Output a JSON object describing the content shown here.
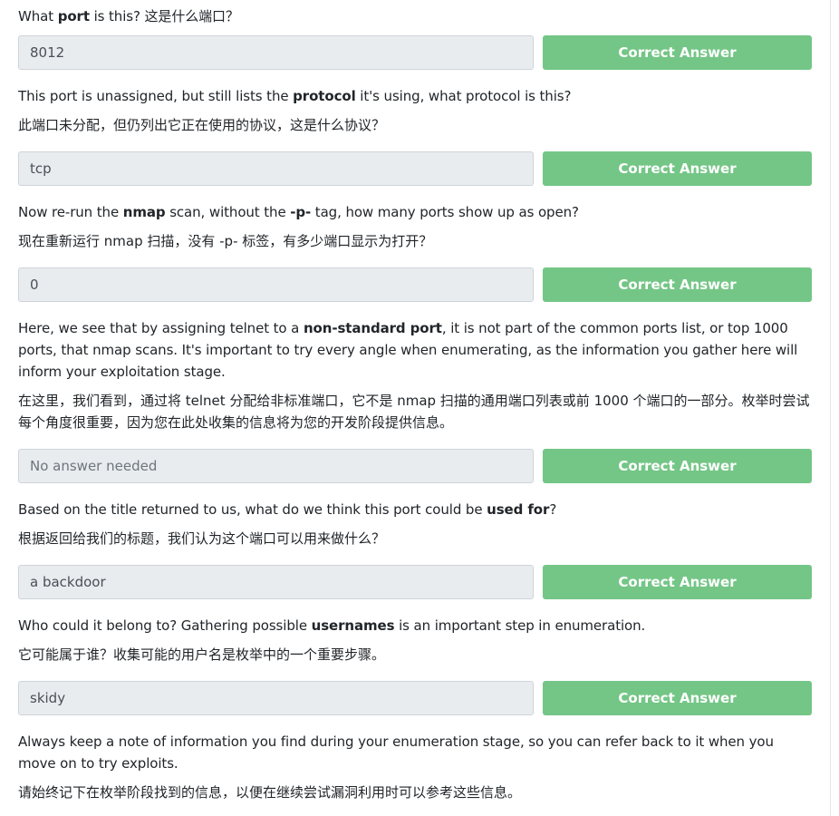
{
  "questions": [
    {
      "en_parts": [
        "What ",
        "port",
        " is this? 这是什么端口？"
      ],
      "zh": "",
      "answer": "8012",
      "button": "Correct Answer"
    },
    {
      "en_parts": [
        "This port is unassigned, but still lists the ",
        "protocol",
        " it's using, what protocol is this?"
      ],
      "zh": "此端口未分配，但仍列出它正在使用的协议，这是什么协议？",
      "answer": "tcp",
      "button": "Correct Answer"
    },
    {
      "en_parts": [
        "Now re-run the ",
        "nmap",
        " scan, without the ",
        "-p-",
        " tag, how many ports show up as open?"
      ],
      "zh": "现在重新运行 nmap 扫描，没有 -p- 标签，有多少端口显示为打开？",
      "answer": "0",
      "button": "Correct Answer"
    },
    {
      "en_parts": [
        "Here, we see that by assigning telnet to a ",
        "non-standard port",
        ", it is not part of the common ports list, or top 1000 ports, that nmap scans. It's important to try every angle when enumerating, as the information you gather here will inform your exploitation stage."
      ],
      "zh": "在这里，我们看到，通过将 telnet 分配给非标准端口，它不是 nmap 扫描的通用端口列表或前 1000 个端口的一部分。枚举时尝试每个角度很重要，因为您在此处收集的信息将为您的开发阶段提供信息。",
      "answer": "No answer needed",
      "button": "Correct Answer"
    },
    {
      "en_parts": [
        "Based on the title returned to us, what do we think this port could be ",
        "used for",
        "?"
      ],
      "zh": "根据返回给我们的标题，我们认为这个端口可以用来做什么？",
      "answer": "a backdoor",
      "button": "Correct Answer"
    },
    {
      "en_parts": [
        "Who could it belong to? Gathering possible ",
        "usernames",
        " is an important step in enumeration."
      ],
      "zh": "它可能属于谁？收集可能的用户名是枚举中的一个重要步骤。",
      "answer": "skidy",
      "button": "Correct Answer"
    }
  ],
  "footer": {
    "en": "Always keep a note of information you find during your enumeration stage, so you can refer back to it when you move on to try exploits.",
    "zh": "请始终记下在枚举阶段找到的信息，以便在继续尝试漏洞利用时可以参考这些信息。"
  }
}
